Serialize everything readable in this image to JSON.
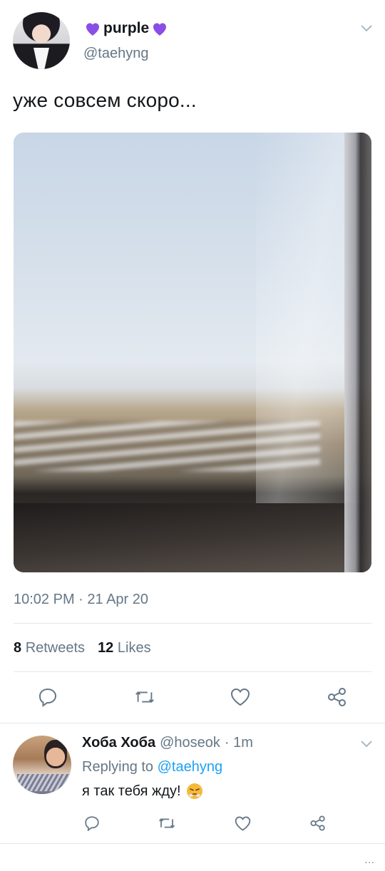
{
  "tweet": {
    "display_name": "purple",
    "handle": "@taehyng",
    "text": "уже совсем скоро...",
    "timestamp": "10:02 PM · 21 Apr 20",
    "stats": {
      "retweets_count": "8",
      "retweets_label": "Retweets",
      "likes_count": "12",
      "likes_label": "Likes"
    }
  },
  "reply": {
    "display_name": "Хоба Хоба",
    "handle": "@hoseok",
    "time": "· 1m",
    "replying_prefix": "Replying to",
    "replying_mention": "@taehyng",
    "text": "я так тебя жду!"
  },
  "icons": {
    "heart_name_decoration": "purple-heart-icon",
    "caret": "chevron-down-icon",
    "reply": "reply-icon",
    "retweet": "retweet-icon",
    "like": "like-icon",
    "share": "share-icon",
    "reply_emoji": "huffing-face-emoji-icon"
  },
  "colors": {
    "accent": "#1da1f2",
    "heart_purple": "#8a4ee6",
    "secondary_text": "#657786",
    "primary_text": "#14171a"
  },
  "more_indicator": "..."
}
